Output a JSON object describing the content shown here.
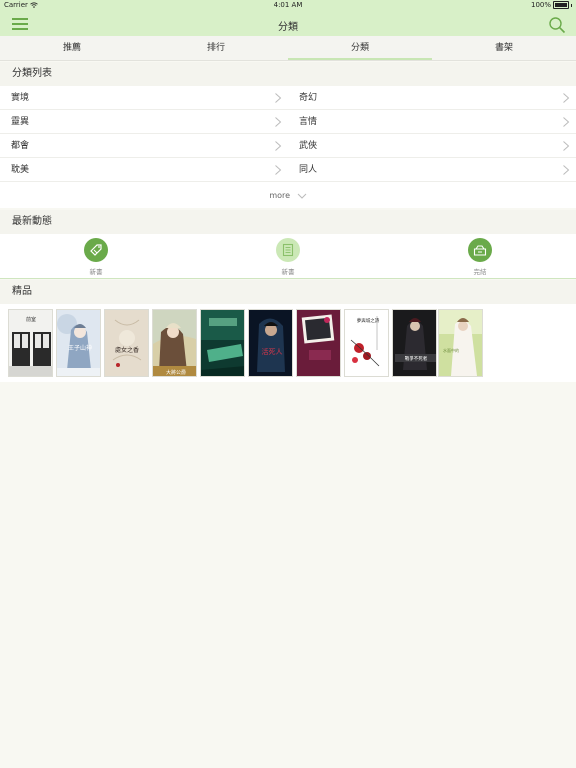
{
  "status_bar": {
    "carrier": "Carrier",
    "time": "4:01 AM",
    "battery": "100%"
  },
  "nav": {
    "title": "分類"
  },
  "tabs": [
    {
      "label": "推薦",
      "active": false
    },
    {
      "label": "排行",
      "active": false
    },
    {
      "label": "分類",
      "active": true
    },
    {
      "label": "書架",
      "active": false
    }
  ],
  "category_section": {
    "title": "分類列表",
    "items": [
      "實境",
      "奇幻",
      "靈異",
      "言情",
      "都會",
      "武俠",
      "耽美",
      "同人"
    ],
    "more_label": "more"
  },
  "news_section": {
    "title": "最新動態",
    "items": [
      {
        "label": "新書",
        "icon": "tag-icon"
      },
      {
        "label": "新書",
        "icon": "book-list-icon"
      },
      {
        "label": "完結",
        "icon": "finished-box-icon"
      }
    ]
  },
  "featured_section": {
    "title": "精品",
    "cover_titles": [
      "前室",
      "王子山神",
      "處女之香",
      "大將公爵",
      "",
      "活死人",
      "",
      "夢與城之詩",
      "戰爭不死者",
      "水面中的"
    ]
  },
  "colors": {
    "header_bg": "#d8f0c8",
    "accent_green": "#6aaa4a",
    "page_bg": "#f8f8f2"
  }
}
